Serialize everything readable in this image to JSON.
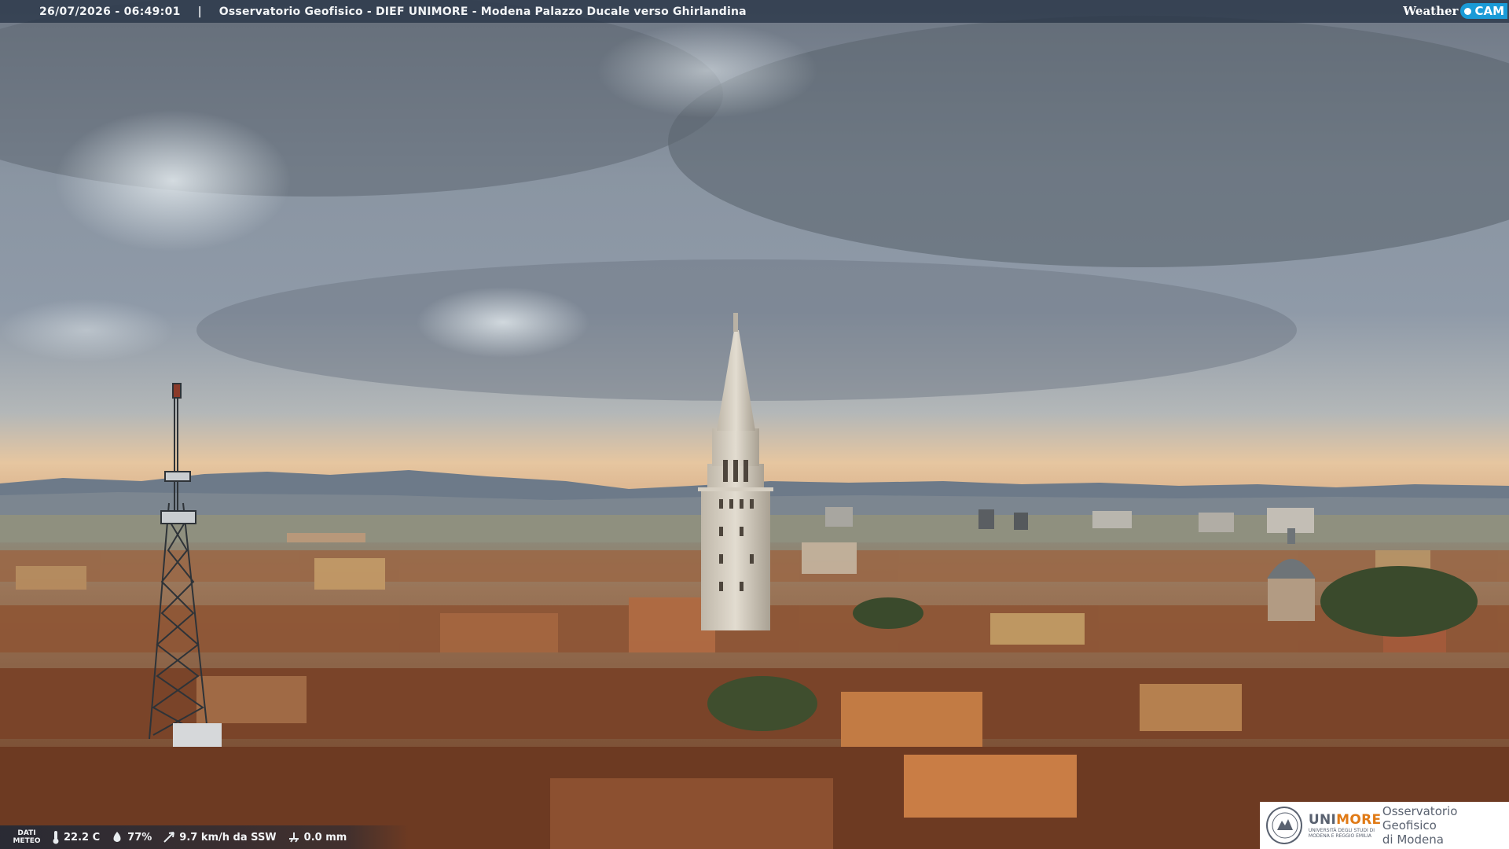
{
  "overlay": {
    "timestamp": "26/07/2026 - 06:49:01",
    "separator": "|",
    "title": "Osservatorio Geofisico - DIEF UNIMORE - Modena Palazzo Ducale verso Ghirlandina",
    "brand_weather": "Weather",
    "brand_cam": "CAM"
  },
  "meteo": {
    "label_line1": "DATI",
    "label_line2": "METEO",
    "temperature": "22.2 C",
    "humidity": "77%",
    "wind": "9.7 km/h da SSW",
    "rain": "0.0 mm"
  },
  "logo": {
    "uni_prefix": "UNI",
    "uni_suffix": "MORE",
    "uni_sub1": "UNIVERSITÀ DEGLI STUDI DI",
    "uni_sub2": "MODENA E REGGIO EMILIA",
    "line1": "Osservatorio Geofisico",
    "line2": "di Modena"
  },
  "colors": {
    "accent_orange": "#e07a16",
    "brand_blue": "#1a9bd7"
  }
}
